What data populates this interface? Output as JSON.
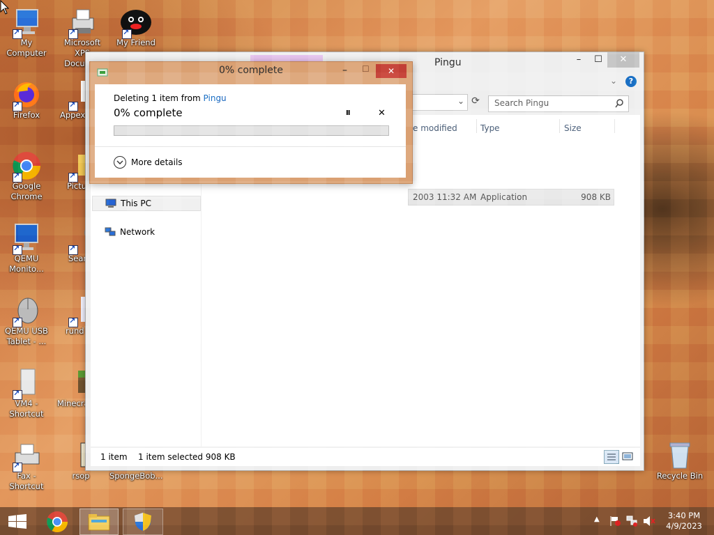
{
  "desktop": {
    "icons": [
      {
        "name": "my-computer",
        "label": "My Computer"
      },
      {
        "name": "microsoft-xps",
        "label": "Microsoft XPS Docum..."
      },
      {
        "name": "my-friend",
        "label": "My Friend"
      },
      {
        "name": "firefox",
        "label": "Firefox"
      },
      {
        "name": "appexs",
        "label": "AppexS"
      },
      {
        "name": "google-chrome",
        "label": "Google Chrome"
      },
      {
        "name": "pictures",
        "label": "Pictu"
      },
      {
        "name": "qemu-monitor",
        "label": "QEMU Monito..."
      },
      {
        "name": "search",
        "label": "Sear"
      },
      {
        "name": "qemu-usb-tablet",
        "label": "QEMU USB Tablet - ..."
      },
      {
        "name": "rund",
        "label": "rund"
      },
      {
        "name": "vm4-shortcut",
        "label": "VM4 - Shortcut"
      },
      {
        "name": "minecraft",
        "label": "Minecra"
      },
      {
        "name": "fax-shortcut",
        "label": "Fax - Shortcut"
      },
      {
        "name": "rsop",
        "label": "rsop"
      },
      {
        "name": "spongebob",
        "label": "SpongeBob..."
      },
      {
        "name": "recycle-bin",
        "label": "Recycle Bin"
      }
    ]
  },
  "explorer": {
    "title": "Pingu",
    "contextual_tab": "Application Tools",
    "search_placeholder": "Search Pingu",
    "columns": {
      "date": "e modified",
      "type": "Type",
      "size": "Size"
    },
    "row": {
      "date": "2003 11:32 AM",
      "type": "Application",
      "size": "908 KB"
    },
    "nav": {
      "this_pc": "This PC",
      "network": "Network"
    },
    "status": {
      "count": "1 item",
      "selected": "1 item selected  908 KB"
    },
    "controls": {
      "minimize": "–",
      "maximize": "☐",
      "close": "✕",
      "help": "?",
      "chevron": "⌄"
    }
  },
  "dialog": {
    "title": "0% complete",
    "deleting_prefix": "Deleting 1 item from ",
    "deleting_location": "Pingu",
    "percent_text": "0% complete",
    "progress": 0,
    "more_details": "More details",
    "pause": "II",
    "cancel": "✕",
    "min": "–",
    "max": "☐",
    "close": "✕"
  },
  "taskbar": {
    "time": "3:40 PM",
    "date": "4/9/2023"
  },
  "colors": {
    "dialog_frame": "#dea97e",
    "link": "#1a6fc4",
    "close_red": "#c7463c"
  }
}
